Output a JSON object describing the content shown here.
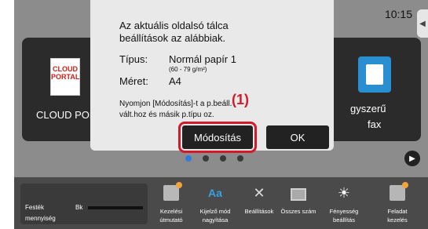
{
  "status": {
    "time": "10:15"
  },
  "tiles": {
    "left": {
      "label": "CLOUD POR",
      "icon": "cloud-portal-icon",
      "icon_text_1": "CLOUD",
      "icon_text_2": "PORTAL"
    },
    "right": {
      "label_1": "gyszerű",
      "label_2": "fax",
      "icon": "fax-icon"
    }
  },
  "dialog": {
    "message_1": "Az aktuális oldalsó tálca",
    "message_2": "beállítások az alábbiak.",
    "type_label": "Típus:",
    "type_value": "Normál papír 1",
    "type_sub": "(60 - 79 g/m²)",
    "size_label": "Méret:",
    "size_value": "A4",
    "hint_1": "Nyomjon [Módosítás]-t a          p.beáll.",
    "hint_2": "vált.hoz és másik p.típu         oz.",
    "callout": "(1)",
    "modify_label": "Módosítás",
    "ok_label": "OK"
  },
  "page_dots": 4,
  "bottom": {
    "toner_label_1": "Festék",
    "toner_label_2": "mennyiség",
    "toner_bk": "Bk",
    "tools": [
      {
        "label_1": "Kezelési",
        "label_2": "útmutató",
        "icon": "manual-icon"
      },
      {
        "label_1": "Kijelző mód",
        "label_2": "nagyítása",
        "icon": "display-zoom-icon"
      },
      {
        "label_1": "Beállítások",
        "label_2": "",
        "icon": "settings-tools-icon"
      },
      {
        "label_1": "Összes szám",
        "label_2": "",
        "icon": "counter-icon"
      },
      {
        "label_1": "Fényesség",
        "label_2": "beállítás",
        "icon": "brightness-icon"
      },
      {
        "label_1": "Feladat",
        "label_2": "kezelés",
        "icon": "job-status-icon"
      }
    ]
  },
  "colors": {
    "accent": "#2f7cd8",
    "callout": "#d11a2a",
    "dialog_bg": "#e9e9e9"
  }
}
